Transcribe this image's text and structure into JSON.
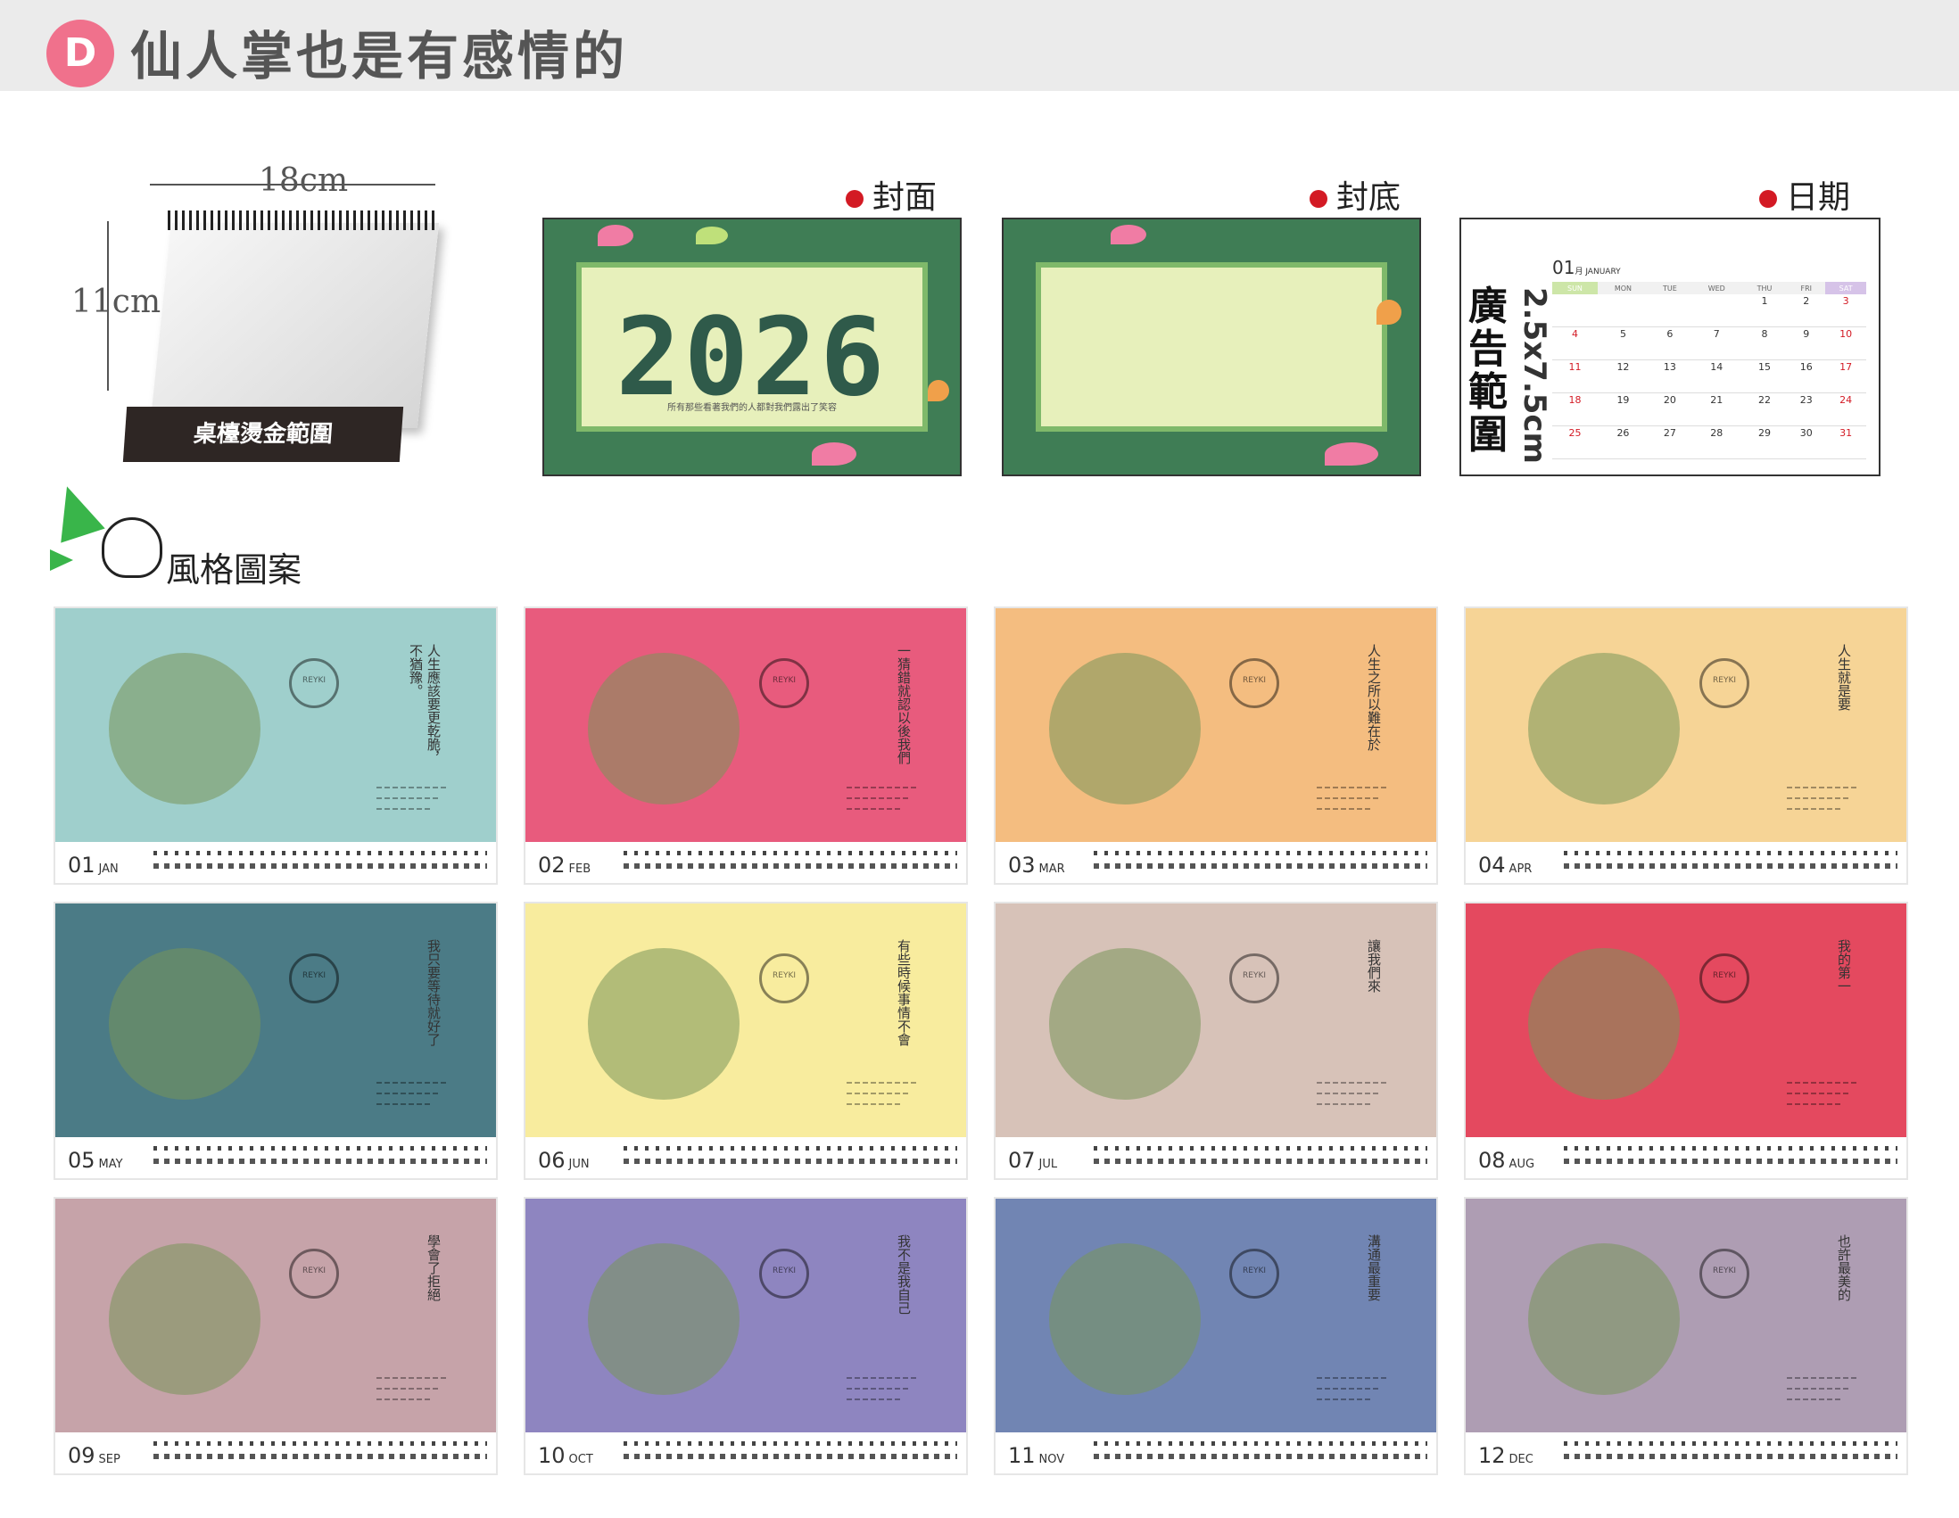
{
  "header": {
    "badge": "D",
    "title": "仙人掌也是有感情的"
  },
  "product": {
    "width_label": "18cm",
    "height_label": "11cm",
    "base_label": "桌檯燙金範圍"
  },
  "sections": {
    "front": "封面",
    "back": "封底",
    "date": "日期",
    "style": "風格圖案"
  },
  "cover": {
    "year": "2026",
    "subtitle": "所有那些看著我們的人都對我們露出了笑容"
  },
  "date_panel": {
    "ad_range": "廣告範圍",
    "ad_size": "2.5x7.5cm",
    "month_num": "01",
    "month_name": "月 JANUARY",
    "weekdays": [
      "SUN",
      "MON",
      "TUE",
      "WED",
      "THU",
      "FRI",
      "SAT"
    ],
    "weeks": [
      [
        "",
        "",
        "",
        "",
        "1",
        "2",
        "3"
      ],
      [
        "4",
        "5",
        "6",
        "7",
        "8",
        "9",
        "10"
      ],
      [
        "11",
        "12",
        "13",
        "14",
        "15",
        "16",
        "17"
      ],
      [
        "18",
        "19",
        "20",
        "21",
        "22",
        "23",
        "24"
      ],
      [
        "25",
        "26",
        "27",
        "28",
        "29",
        "30",
        "31"
      ]
    ]
  },
  "months": [
    {
      "num": "01",
      "abbr": "JAN",
      "bg": "#9fcfcc"
    },
    {
      "num": "02",
      "abbr": "FEB",
      "bg": "#e85b7d"
    },
    {
      "num": "03",
      "abbr": "MAR",
      "bg": "#f4bd80"
    },
    {
      "num": "04",
      "abbr": "APR",
      "bg": "#f6d496"
    },
    {
      "num": "05",
      "abbr": "MAY",
      "bg": "#4b7b86"
    },
    {
      "num": "06",
      "abbr": "JUN",
      "bg": "#f8ec9e"
    },
    {
      "num": "07",
      "abbr": "JUL",
      "bg": "#d7c2b8"
    },
    {
      "num": "08",
      "abbr": "AUG",
      "bg": "#e4495f"
    },
    {
      "num": "09",
      "abbr": "SEP",
      "bg": "#c6a3a9"
    },
    {
      "num": "10",
      "abbr": "OCT",
      "bg": "#8e85c0"
    },
    {
      "num": "11",
      "abbr": "NOV",
      "bg": "#7185b3"
    },
    {
      "num": "12",
      "abbr": "DEC",
      "bg": "#ae9db3"
    }
  ]
}
